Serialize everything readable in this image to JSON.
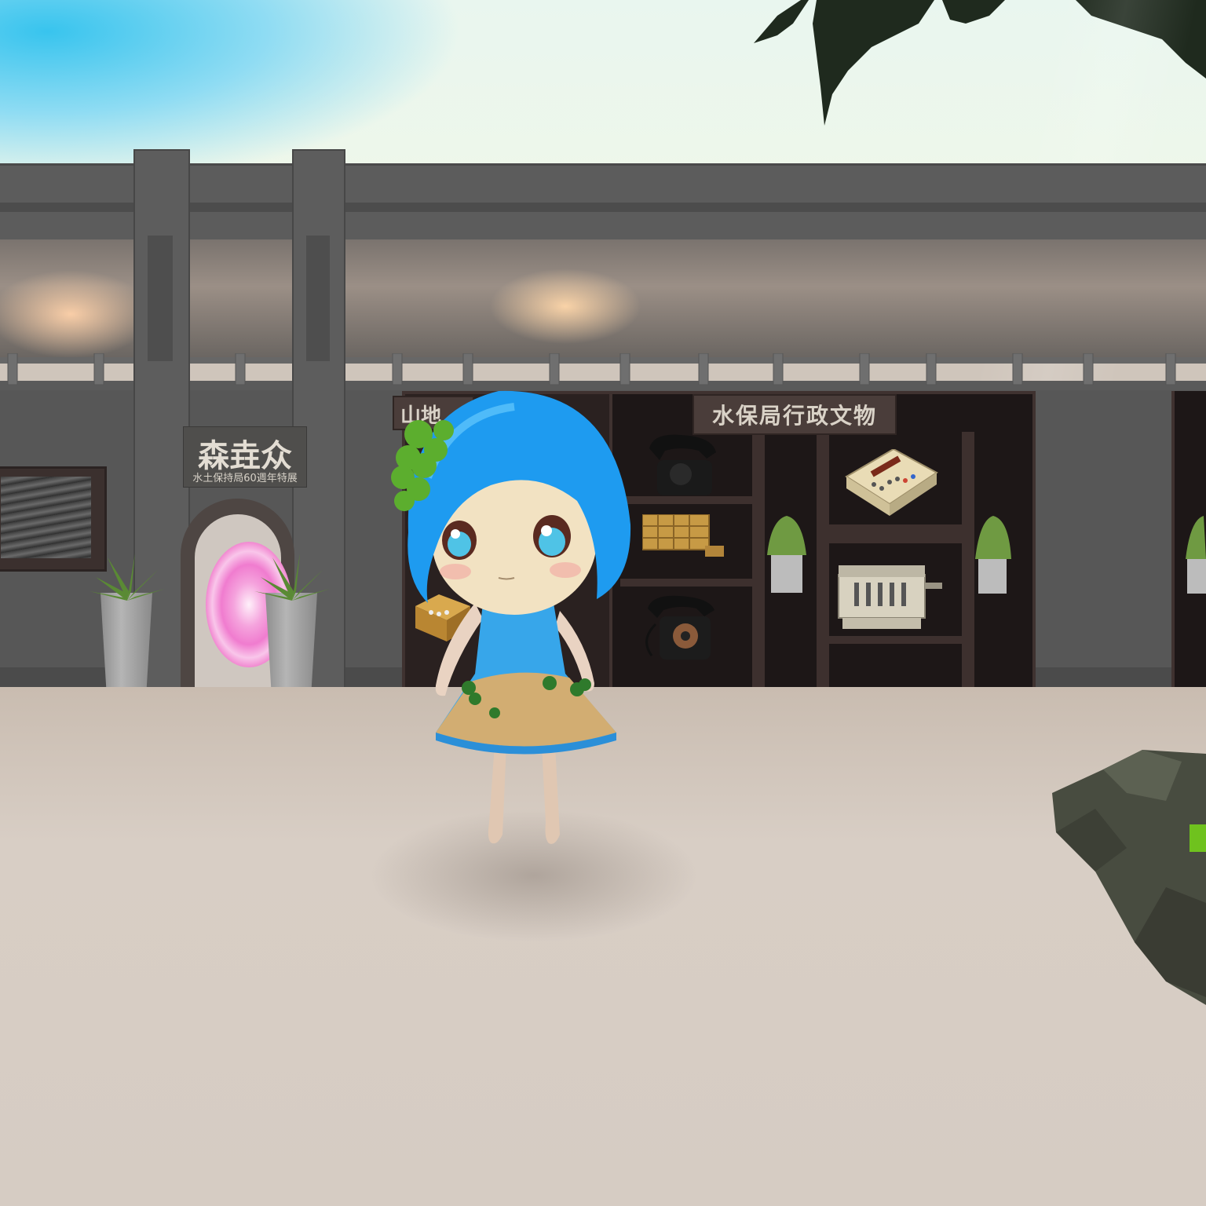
{
  "scene": {
    "signs": {
      "exhibit_title": "水保局行政文物",
      "gallery_title": "森垚众",
      "gallery_subtitle": "水土保持局60週年特展",
      "partial_sign": "山地"
    },
    "colors": {
      "character_hair": "#1e9bf0",
      "character_dress": "#37a6ea",
      "building": "#5d5d5d",
      "cabinet": "#2a2120",
      "portal": "#f07ccf"
    }
  }
}
